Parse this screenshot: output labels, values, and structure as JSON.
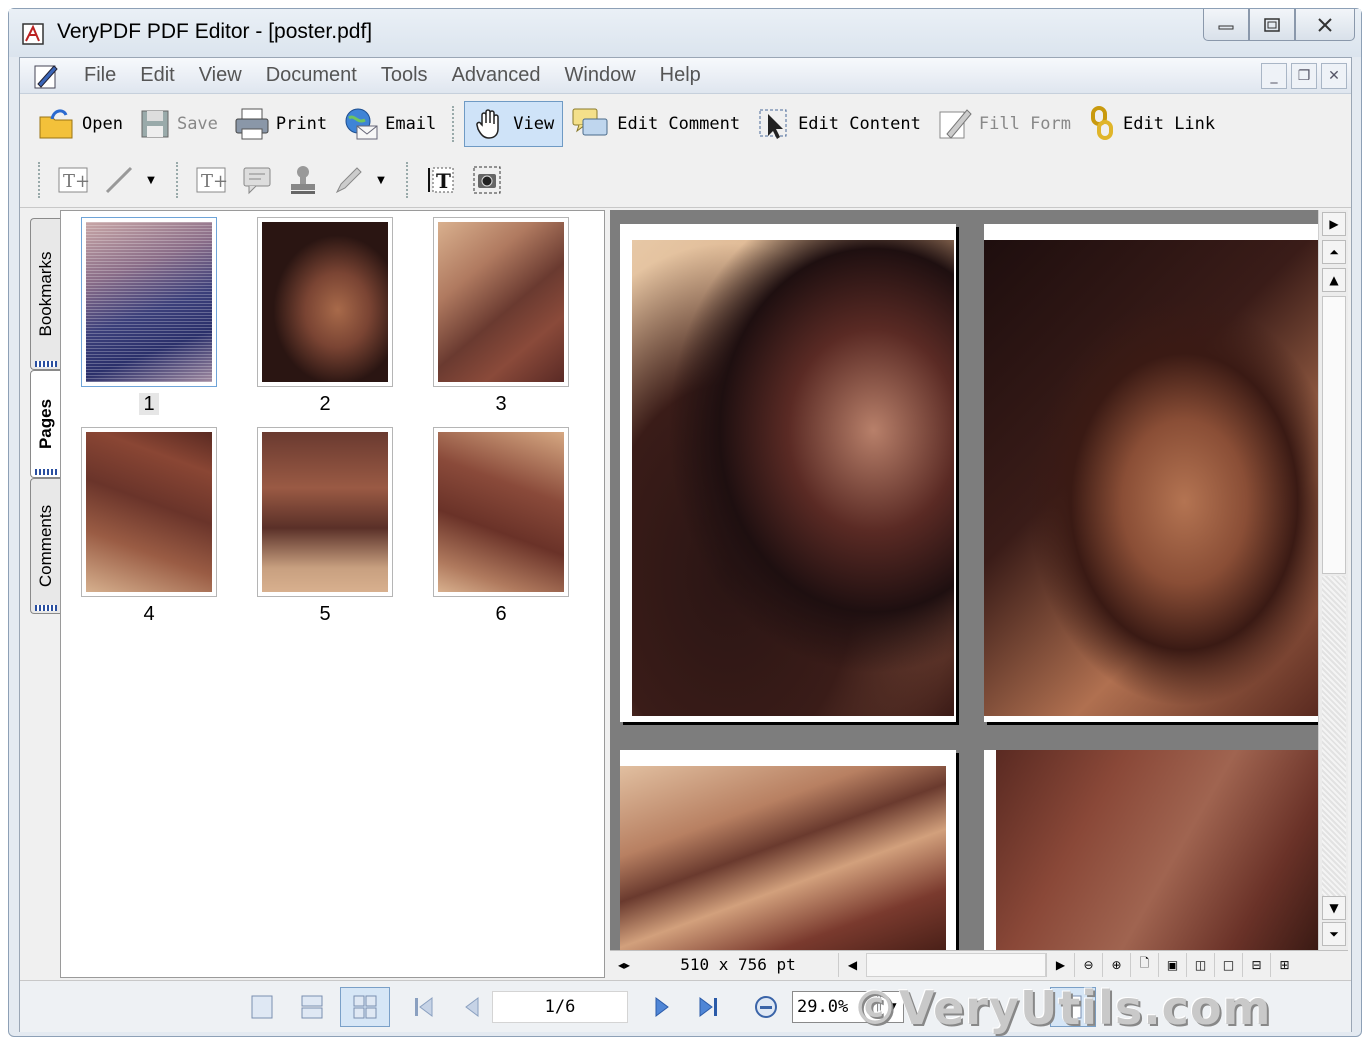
{
  "window": {
    "title": "VeryPDF PDF Editor - [poster.pdf]"
  },
  "menu": {
    "items": [
      "File",
      "Edit",
      "View",
      "Document",
      "Tools",
      "Advanced",
      "Window",
      "Help"
    ]
  },
  "toolbar": {
    "open": "Open",
    "save": "Save",
    "print": "Print",
    "email": "Email",
    "view": "View",
    "edit_comment": "Edit Comment",
    "edit_content": "Edit Content",
    "fill_form": "Fill Form",
    "edit_link": "Edit Link"
  },
  "sidetabs": {
    "bookmarks": "Bookmarks",
    "pages": "Pages",
    "comments": "Comments"
  },
  "thumbnails": {
    "labels": [
      "1",
      "2",
      "3",
      "4",
      "5",
      "6"
    ]
  },
  "status": {
    "page_size": "510 x 756 pt"
  },
  "navigation": {
    "page_indicator": "1/6",
    "zoom": "29.0%"
  },
  "watermark": {
    "text": "©VeryUtils.com"
  },
  "colors": {
    "accent": "#2a4fa0",
    "viewer_bg": "#7d7d7d",
    "selection": "#cfe3f8"
  }
}
